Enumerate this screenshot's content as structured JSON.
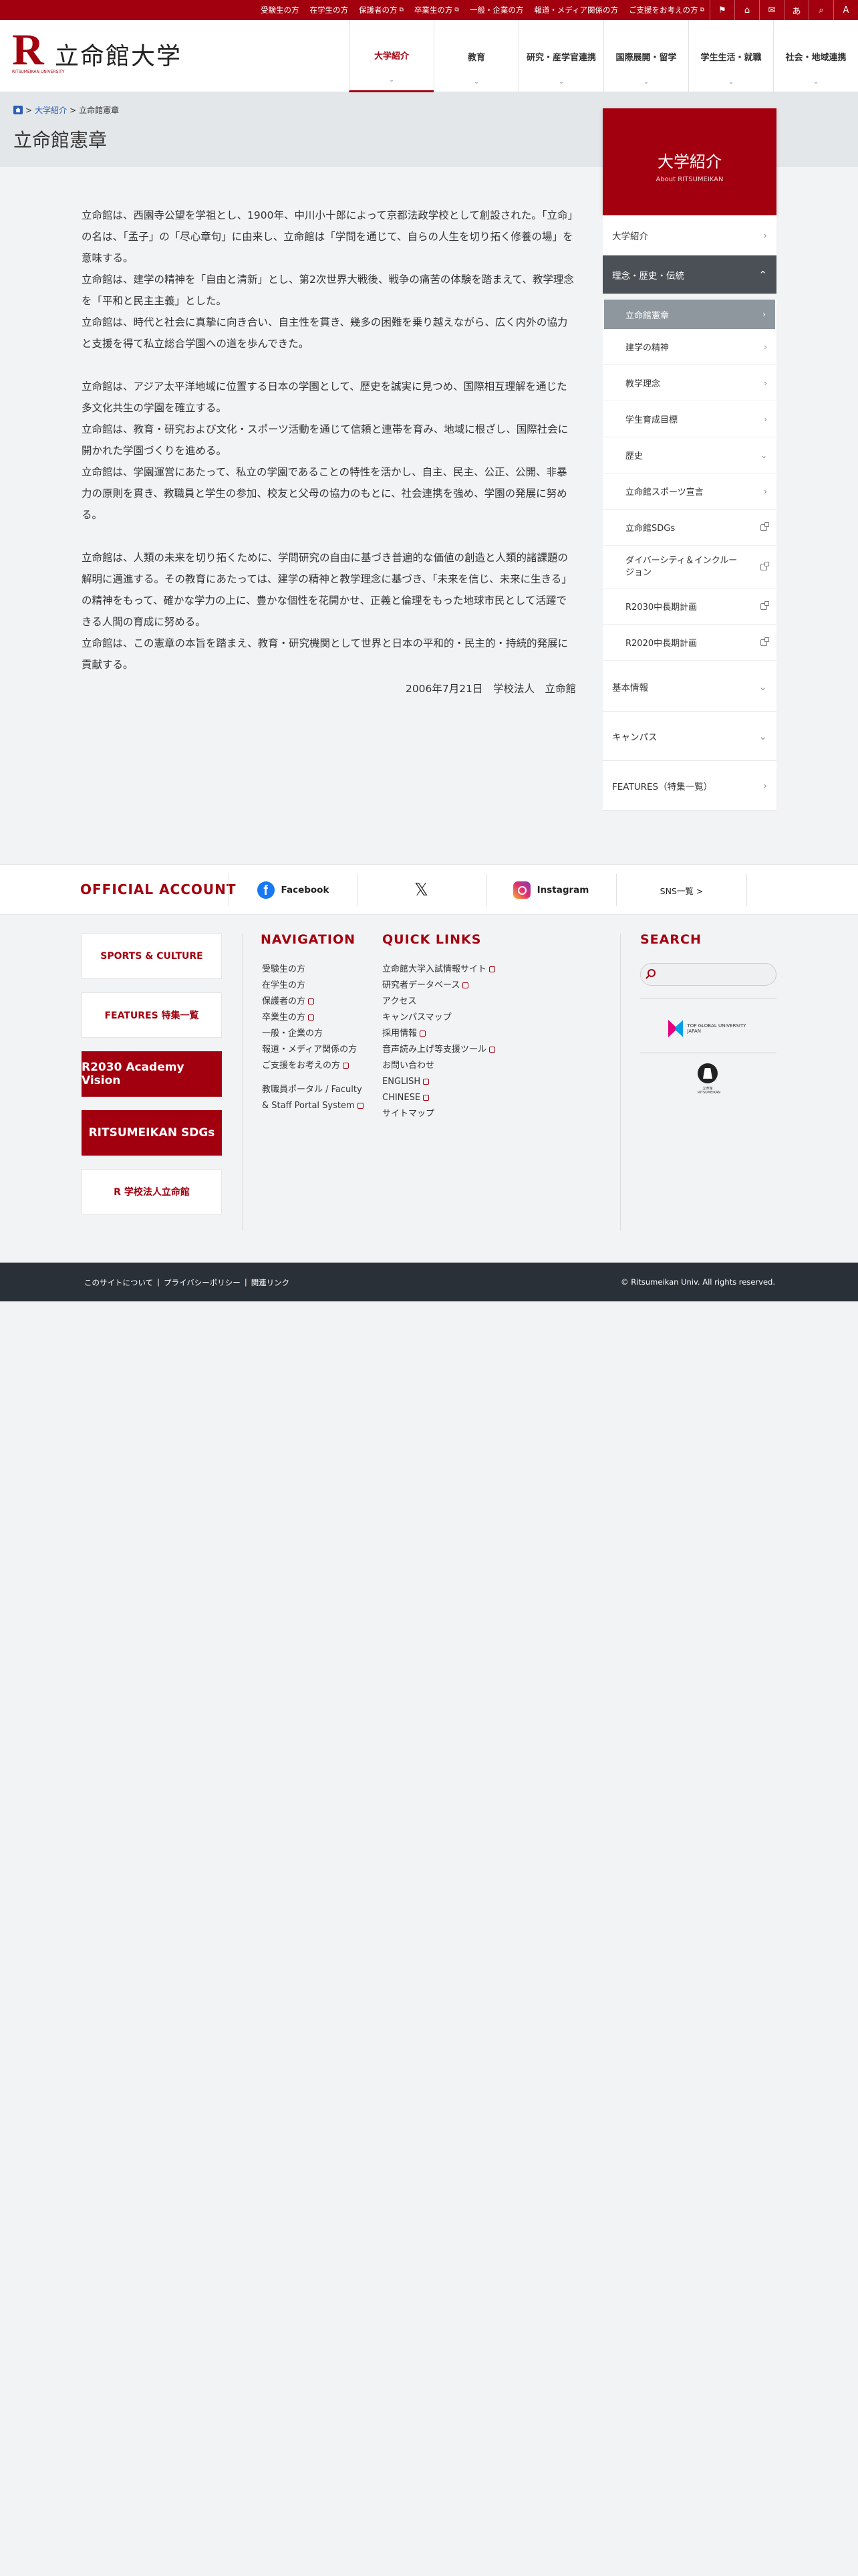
{
  "topbar": {
    "links": [
      {
        "label": "受験生の方",
        "ext": false
      },
      {
        "label": "在学生の方",
        "ext": false
      },
      {
        "label": "保護者の方",
        "ext": true
      },
      {
        "label": "卒業生の方",
        "ext": true
      },
      {
        "label": "一般・企業の方",
        "ext": false
      },
      {
        "label": "報道・メディア関係の方",
        "ext": false
      },
      {
        "label": "ご支援をお考えの方",
        "ext": true
      }
    ],
    "icons": [
      "map-icon",
      "building-icon",
      "mail-icon",
      "language-icon",
      "search-icon",
      "font-size-icon"
    ],
    "icon_glyphs": [
      "⚑",
      "⌂",
      "✉",
      "あ",
      "⌕",
      "A"
    ],
    "colors": {
      "brand": "#a3000f"
    }
  },
  "header": {
    "logo_letter": "R",
    "logo_sub": "RITSUMEIKAN UNIVERSITY",
    "logo_name": "立命館大学",
    "nav": [
      {
        "label": "大学紹介",
        "active": true
      },
      {
        "label": "教育",
        "active": false
      },
      {
        "label": "研究・産学官連携",
        "active": false
      },
      {
        "label": "国際展開・留学",
        "active": false
      },
      {
        "label": "学生生活・就職",
        "active": false
      },
      {
        "label": "社会・地域連携",
        "active": false
      }
    ]
  },
  "breadcrumb": {
    "items": [
      "大学紹介",
      "立命館憲章"
    ],
    "sep": ">"
  },
  "page_title": "立命館憲章",
  "article": {
    "blocks": [
      [
        "立命館は、西園寺公望を学祖とし、1900年、中川小十郎によって京都法政学校として創設された。「立命」の名は、「孟子」の「尽心章句」に由来し、立命館は「学問を通じて、自らの人生を切り拓く修養の場」を意味する。",
        "立命館は、建学の精神を「自由と清新」とし、第2次世界大戦後、戦争の痛苦の体験を踏まえて、教学理念を「平和と民主主義」とした。",
        "立命館は、時代と社会に真摯に向き合い、自主性を貫き、幾多の困難を乗り越えながら、広く内外の協力と支援を得て私立総合学園への道を歩んできた。"
      ],
      [
        "立命館は、アジア太平洋地域に位置する日本の学園として、歴史を誠実に見つめ、国際相互理解を通じた多文化共生の学園を確立する。",
        "立命館は、教育・研究および文化・スポーツ活動を通じて信頼と連帯を育み、地域に根ざし、国際社会に開かれた学園づくりを進める。",
        "立命館は、学園運営にあたって、私立の学園であることの特性を活かし、自主、民主、公正、公開、非暴力の原則を貫き、教職員と学生の参加、校友と父母の協力のもとに、社会連携を強め、学園の発展に努める。"
      ],
      [
        "立命館は、人類の未来を切り拓くために、学問研究の自由に基づき普遍的な価値の創造と人類的諸課題の解明に邁進する。その教育にあたっては、建学の精神と教学理念に基づき、「未来を信じ、未来に生きる」の精神をもって、確かな学力の上に、豊かな個性を花開かせ、正義と倫理をもった地球市民として活躍できる人間の育成に努める。",
        "立命館は、この憲章の本旨を踏まえ、教育・研究機関として世界と日本の平和的・民主的・持続的発展に貢献する。"
      ]
    ],
    "signature": "2006年7月21日　学校法人　立命館"
  },
  "sidebar": {
    "title": "大学紹介",
    "subtitle": "About RITSUMEIKAN",
    "top_item": "大学紹介",
    "open_section": "理念・歴史・伝統",
    "sub_items": [
      {
        "label": "立命館憲章",
        "icon": "arrow",
        "current": true
      },
      {
        "label": "建学の精神",
        "icon": "arrow"
      },
      {
        "label": "教学理念",
        "icon": "arrow"
      },
      {
        "label": "学生育成目標",
        "icon": "arrow"
      },
      {
        "label": "歴史",
        "icon": "down"
      },
      {
        "label": "立命館スポーツ宣言",
        "icon": "arrow"
      },
      {
        "label": "立命館SDGs",
        "icon": "ext"
      },
      {
        "label": "ダイバーシティ＆インクルージョン",
        "icon": "ext",
        "two": true
      },
      {
        "label": "R2030中長期計画",
        "icon": "ext"
      },
      {
        "label": "R2020中長期計画",
        "icon": "ext"
      }
    ],
    "bottom_items": [
      {
        "label": "基本情報",
        "icon": "down"
      },
      {
        "label": "キャンパス",
        "icon": "down"
      },
      {
        "label": "FEATURES（特集一覧）",
        "icon": "arrow"
      }
    ]
  },
  "official": {
    "title": "OFFICIAL ACCOUNT",
    "sns": [
      {
        "label": "Facebook",
        "icon": "facebook-icon"
      },
      {
        "label": "X",
        "icon": "x-icon"
      },
      {
        "label": "Instagram",
        "icon": "instagram-icon"
      },
      {
        "label": "SNS一覧 >",
        "icon": ""
      }
    ]
  },
  "footer": {
    "banners": [
      {
        "label": "SPORTS & CULTURE",
        "style": "w"
      },
      {
        "label": "FEATURES 特集一覧",
        "style": "w"
      },
      {
        "label": "R2030 Academy Vision",
        "style": "r"
      },
      {
        "label": "RITSUMEIKAN SDGs",
        "style": "r"
      },
      {
        "label": "R 学校法人立命館",
        "style": "w"
      }
    ],
    "navigation_title": "NAVIGATION",
    "navigation": [
      {
        "label": "受験生の方",
        "ext": false
      },
      {
        "label": "在学生の方",
        "ext": false
      },
      {
        "label": "保護者の方",
        "ext": true
      },
      {
        "label": "卒業生の方",
        "ext": true
      },
      {
        "label": "一般・企業の方",
        "ext": false
      },
      {
        "label": "報道・メディア関係の方",
        "ext": false
      },
      {
        "label": "ご支援をお考えの方",
        "ext": true
      },
      {
        "label": "",
        "ext": false
      },
      {
        "label": "教職員ポータル / Faculty & Staff Portal System",
        "ext": true
      }
    ],
    "quicklinks_title": "QUICK LINKS",
    "quicklinks": [
      {
        "label": "立命館大学入試情報サイト",
        "ext": true
      },
      {
        "label": "研究者データベース",
        "ext": true
      },
      {
        "label": "アクセス",
        "ext": false
      },
      {
        "label": "キャンパスマップ",
        "ext": false
      },
      {
        "label": "採用情報",
        "ext": true
      },
      {
        "label": "音声読み上げ等支援ツール",
        "ext": true
      },
      {
        "label": "お問い合わせ",
        "ext": false
      },
      {
        "label": "ENGLISH",
        "ext": true
      },
      {
        "label": "CHINESE",
        "ext": true
      },
      {
        "label": "サイトマップ",
        "ext": false
      }
    ],
    "search_title": "SEARCH",
    "tgu_label": "TOP GLOBAL UNIVERSITY JAPAN",
    "emblem_label": "立命館 RITSUMEIKAN"
  },
  "bottombar": {
    "links": [
      "このサイトについて",
      "プライバシーポリシー",
      "関連リンク"
    ],
    "copyright": "© Ritsumeikan Univ. All rights reserved."
  }
}
